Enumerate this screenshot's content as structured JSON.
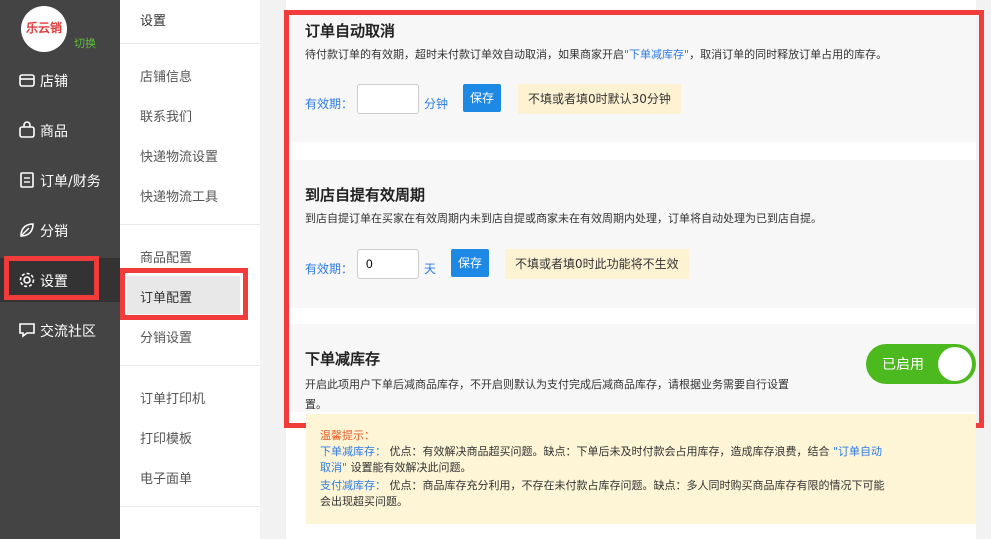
{
  "logo": {
    "text": "乐云销",
    "switch": "切换"
  },
  "sidebar": {
    "items": [
      {
        "label": "店铺",
        "icon": "store-icon"
      },
      {
        "label": "商品",
        "icon": "bag-icon"
      },
      {
        "label": "订单/财务",
        "icon": "document-icon"
      },
      {
        "label": "分销",
        "icon": "leaf-icon"
      },
      {
        "label": "设置",
        "icon": "gear-icon"
      },
      {
        "label": "交流社区",
        "icon": "chat-icon"
      }
    ]
  },
  "submenu": {
    "title": "设置",
    "items": [
      "店铺信息",
      "联系我们",
      "快递物流设置",
      "快递物流工具",
      "商品配置",
      "订单配置",
      "分销设置",
      "订单打印机",
      "打印模板",
      "电子面单"
    ],
    "active": "订单配置"
  },
  "auto_cancel": {
    "title": "订单自动取消",
    "desc_pre": "待付款订单的有效期，超时未付款订单效自动取消，如果商家开启",
    "desc_link": "\"下单减库存\"",
    "desc_post": "，取消订单的同时释放订单占用的库存。",
    "label": "有效期：",
    "value": "",
    "unit": "分钟",
    "save": "保存",
    "tip": "不填或者填0时默认30分钟"
  },
  "pickup": {
    "title": "到店自提有效周期",
    "desc": "到店自提订单在买家在有效周期内未到店自提或商家未在有效周期内处理，订单将自动处理为已到店自提。",
    "label": "有效期：",
    "value": "0",
    "unit": "天",
    "save": "保存",
    "tip": "不填或者填0时此功能将不生效"
  },
  "reduce_stock": {
    "title": "下单减库存",
    "desc_1": "开启此项用户下单后减商品库存，不开启则默认为支付完成后减商品库存，请根据业务需要自行设置",
    "desc_2": "置。",
    "toggle_label": "已启用",
    "enabled": true
  },
  "hint": {
    "title": "温馨提示：",
    "l1_link": "下单减库存：",
    "l1_text": "优点：有效解决商品超买问题。缺点：下单后未及时付款会占用库存，造成库存浪费，结合",
    "l1_link2": "\"订单自动",
    "l2_link": "取消\"",
    "l2_text": "设置能有效解决此问题。",
    "l3_link": "支付减库存：",
    "l3_text": "优点：商品库存充分利用，不存在未付款占库存问题。缺点：多人同时购买商品库存有限的情况下可能",
    "l4_text": "会出现超买问题。"
  },
  "colors": {
    "highlight": "#f23c3c",
    "accent": "#1e88e5",
    "toggle_on": "#4cb91f"
  }
}
